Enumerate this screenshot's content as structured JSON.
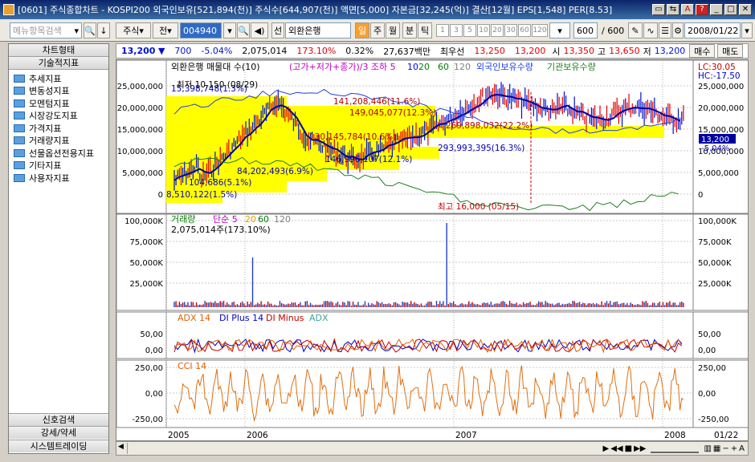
{
  "window": {
    "title": "[0601] 주식종합차트 - KOSPI200 외국인보유[521,894(천)] 주식수[644,907(천)] 액면[5,000] 자본금[32,245(억)] 결산[12월] EPS[1,548] PER[8.53]"
  },
  "toolbar": {
    "menu_search": "메뉴항목검색",
    "type": "주식",
    "prev": "전",
    "code": "004940",
    "kind": "선",
    "stock_name": "외환은행",
    "period_il": "일",
    "period_ju": "주",
    "period_wol": "월",
    "period_bun": "분",
    "period_tik": "틱",
    "minute_buttons": [
      "1",
      "3",
      "5",
      "10",
      "20",
      "30",
      "60",
      "120"
    ],
    "count_value": "600",
    "count_total": "/ 600",
    "date": "2008/01/22"
  },
  "sidebar": {
    "header1": "차트형태",
    "header2": "기술적지표",
    "items": [
      "추세지표",
      "변동성지표",
      "모멘텀지표",
      "시장강도지표",
      "가격지표",
      "거래량지표",
      "선물옵션전용지표",
      "기타지표",
      "사용자지표"
    ],
    "footer": [
      "신호검색",
      "강세/약세",
      "시스템트레이딩"
    ]
  },
  "info": {
    "price": "13,200",
    "arrow": "▼",
    "change": "700",
    "change_pct": "-5.04%",
    "volume": "2,075,014",
    "vol_pct": "173.10%",
    "turnover": "0.32%",
    "amount": "27,637백만",
    "label_choe": "최우선",
    "bid": "13,250",
    "ask": "13,200",
    "open_label": "시",
    "open": "13,350",
    "high_label": "고",
    "high": "13,650",
    "low_label": "저",
    "low": "13,200",
    "buy": "매수",
    "sell": "매도"
  },
  "price_panel": {
    "title": "외환은행 매물대 수(10)",
    "legend": [
      "(고가+저가+종가)/3 조하 5",
      "10",
      "20",
      "60",
      "120",
      "외국인보유수량",
      "기관보유수량"
    ],
    "high_label": "최고 16,000 (05/15)",
    "low_label": "최저 10,150 (08/29)",
    "right_lc": "LC:30.05",
    "right_hc": "HC:-17.50",
    "current_price_tag": "13,200",
    "current_pct_tag": "-5.04%",
    "left_ticks": [
      "25,000,000",
      "20,000,000",
      "15,000,000",
      "10,000,000",
      "5,000,000",
      "0"
    ],
    "right_ticks": [
      "25,000,000",
      "20,000,000",
      "15,000,000",
      "10,000,000",
      "5,000,000",
      "0"
    ],
    "volume_bars": [
      "15,398,748(1.3%)",
      "141,208,446(11.6%)",
      "149,045,077(12.3%)",
      "269,898,032(22.2%)",
      "130,145,784(10.6%)",
      "293,993,395(16.3%)",
      "146,996,107(12.1%)",
      "84,202,493(6.9%)",
      "104,686(5.1%)",
      "8,510,122(1.5%)"
    ]
  },
  "volume_panel": {
    "title": "거래량",
    "legend": [
      "단순 5",
      "20",
      "60",
      "120"
    ],
    "value": "2,075,014주(173.10%)",
    "ticks": [
      "100,000K",
      "75,000K",
      "50,000K",
      "25,000K"
    ]
  },
  "adx_panel": {
    "legend": [
      "ADX 14",
      "DI Plus 14",
      "DI Minus",
      "ADX"
    ],
    "ticks": [
      "50,00",
      "0,00"
    ]
  },
  "cci_panel": {
    "legend": [
      "CCI 14"
    ],
    "ticks": [
      "250,00",
      "0,00",
      "-250,00"
    ]
  },
  "x_axis": {
    "labels": [
      "2005",
      "2006",
      "2007",
      "2008",
      "01/22"
    ]
  },
  "colors": {
    "accent": "#0a246a",
    "price_up": "#e00000",
    "price_down": "#0010d0",
    "volume_profile": "#ffff00"
  }
}
